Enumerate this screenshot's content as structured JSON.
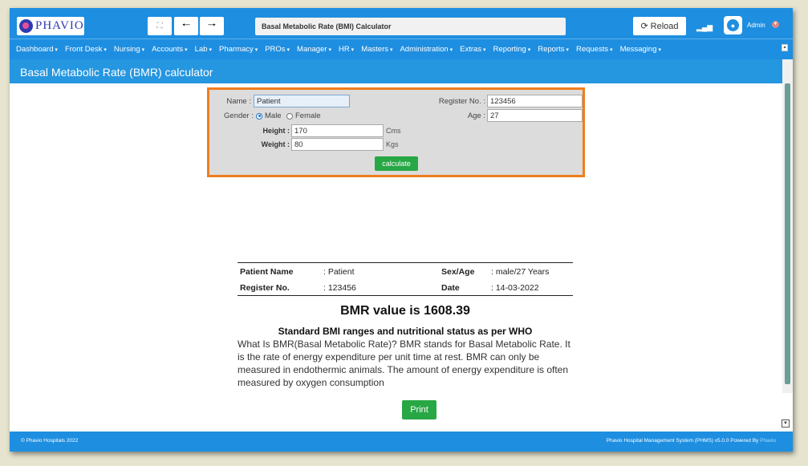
{
  "header": {
    "logo_text": "PHAVIO",
    "page_title": "Basal Metabolic Rate (BMI) Calculator",
    "reload_label": "Reload",
    "user_name": "Admin"
  },
  "menu": {
    "items": [
      "Dashboard",
      "Front Desk",
      "Nursing",
      "Accounts",
      "Lab",
      "Pharmacy",
      "PROs",
      "Manager",
      "HR",
      "Masters",
      "Administration",
      "Extras",
      "Reporting",
      "Reports",
      "Requests",
      "Messaging"
    ]
  },
  "page": {
    "heading": "Basal Metabolic Rate (BMR) calculator"
  },
  "form": {
    "name_label": "Name :",
    "name_value": "Patient",
    "register_label": "Register No. :",
    "register_value": "123456",
    "gender_label": "Gender :",
    "gender_options": [
      "Male",
      "Female"
    ],
    "gender_selected": "Male",
    "age_label": "Age :",
    "age_value": "27",
    "height_label": "Height :",
    "height_value": "170",
    "height_unit": "Cms",
    "weight_label": "Weight :",
    "weight_value": "80",
    "weight_unit": "Kgs",
    "calculate_label": "calculate"
  },
  "report": {
    "patient_name_label": "Patient Name",
    "patient_name_value": ": Patient",
    "sex_age_label": "Sex/Age",
    "sex_age_value": ": male/27 Years",
    "register_label": "Register No.",
    "register_value": ": 123456",
    "date_label": "Date",
    "date_value": ": 14-03-2022",
    "bmr_text": "BMR value is 1608.39",
    "ranges_title": "Standard BMI ranges and nutritional status as per WHO",
    "description": "What Is BMR(Basal Metabolic Rate)? BMR stands for Basal Metabolic Rate. It is the rate of energy expenditure per unit time at rest. BMR can only be measured in endothermic animals. The amount of energy expenditure is often measured by oxygen consumption",
    "print_label": "Print"
  },
  "footer": {
    "left": "© Phavio Hospitals 2022",
    "right": "Phavio Hospital Management System (PHMS) v5.0.0 Powered By",
    "brand": "Phavio"
  },
  "colors": {
    "primary": "#1e8ee0",
    "accent_border": "#f07d1e",
    "button_green": "#28a745"
  }
}
